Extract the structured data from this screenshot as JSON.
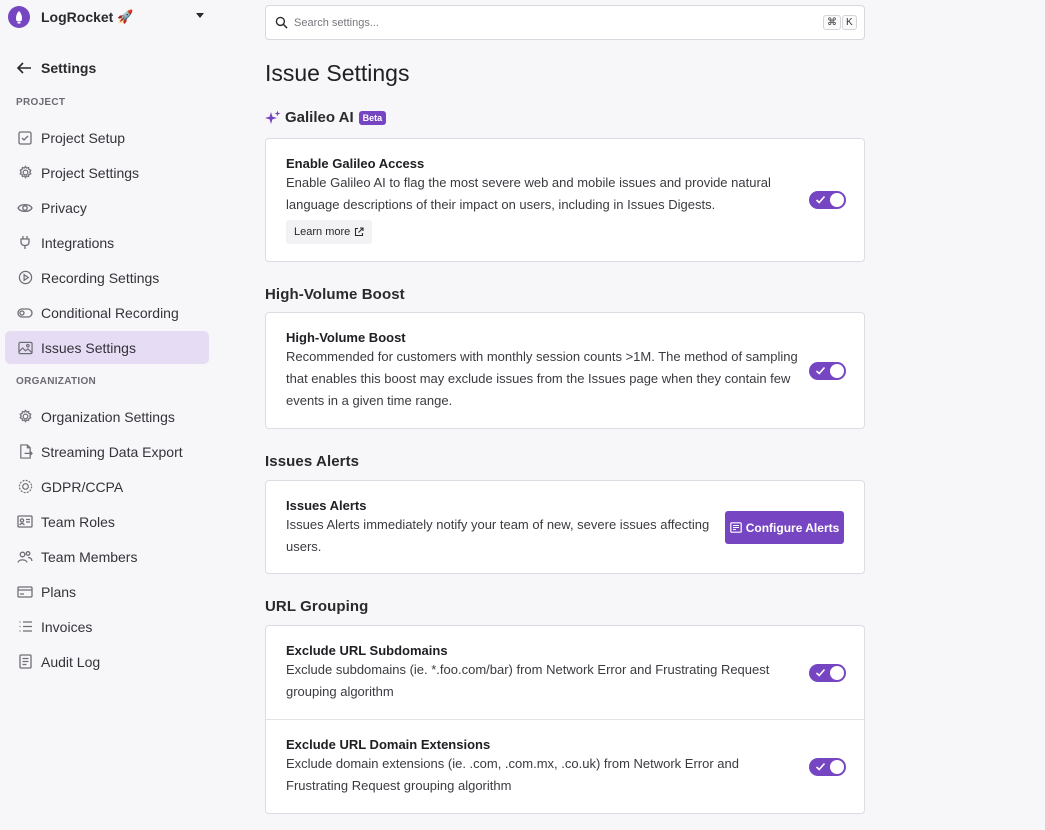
{
  "sidebar": {
    "org_name": "LogRocket",
    "org_emoji": "🚀",
    "back_label": "Settings",
    "project_section": "PROJECT",
    "organization_section": "ORGANIZATION",
    "project_items": [
      {
        "label": "Project Setup",
        "icon": "checkbox-icon"
      },
      {
        "label": "Project Settings",
        "icon": "gear-icon"
      },
      {
        "label": "Privacy",
        "icon": "eye-icon"
      },
      {
        "label": "Integrations",
        "icon": "plug-icon"
      },
      {
        "label": "Recording Settings",
        "icon": "play-circle-icon"
      },
      {
        "label": "Conditional Recording",
        "icon": "toggle-icon"
      },
      {
        "label": "Issues Settings",
        "icon": "image-icon",
        "active": true
      }
    ],
    "organization_items": [
      {
        "label": "Organization Settings",
        "icon": "gear-icon"
      },
      {
        "label": "Streaming Data Export",
        "icon": "file-export-icon"
      },
      {
        "label": "GDPR/CCPA",
        "icon": "badge-icon"
      },
      {
        "label": "Team Roles",
        "icon": "id-card-icon"
      },
      {
        "label": "Team Members",
        "icon": "users-icon"
      },
      {
        "label": "Plans",
        "icon": "credit-card-icon"
      },
      {
        "label": "Invoices",
        "icon": "list-icon"
      },
      {
        "label": "Audit Log",
        "icon": "document-icon"
      }
    ]
  },
  "search": {
    "placeholder": "Search settings...",
    "shortcut_keys": [
      "⌘",
      "K"
    ]
  },
  "main": {
    "page_title": "Issue Settings",
    "galileo": {
      "section_title": "Galileo AI",
      "badge": "Beta",
      "setting_title": "Enable Galileo Access",
      "setting_desc": "Enable Galileo AI to flag the most severe web and mobile issues and provide natural language descriptions of their impact on users, including in Issues Digests.",
      "learn_more": "Learn more",
      "enabled": true
    },
    "high_volume": {
      "section_title": "High-Volume Boost",
      "setting_title": "High-Volume Boost",
      "setting_desc": "Recommended for customers with monthly session counts >1M. The method of sampling that enables this boost may exclude issues from the Issues page when they contain few events in a given time range.",
      "enabled": true
    },
    "alerts": {
      "section_title": "Issues Alerts",
      "setting_title": "Issues Alerts",
      "setting_desc": "Issues Alerts immediately notify your team of new, severe issues affecting users.",
      "button_label": "Configure Alerts"
    },
    "url_grouping": {
      "section_title": "URL Grouping",
      "subdomains_title": "Exclude URL Subdomains",
      "subdomains_desc": "Exclude subdomains (ie. *.foo.com/bar) from Network Error and Frustrating Request grouping algorithm",
      "subdomains_enabled": true,
      "extensions_title": "Exclude URL Domain Extensions",
      "extensions_desc": "Exclude domain extensions (ie. .com, .com.mx, .co.uk) from Network Error and Frustrating Request grouping algorithm",
      "extensions_enabled": true
    }
  },
  "colors": {
    "accent": "#7646c2",
    "active_nav_bg": "#e6ddf4"
  }
}
